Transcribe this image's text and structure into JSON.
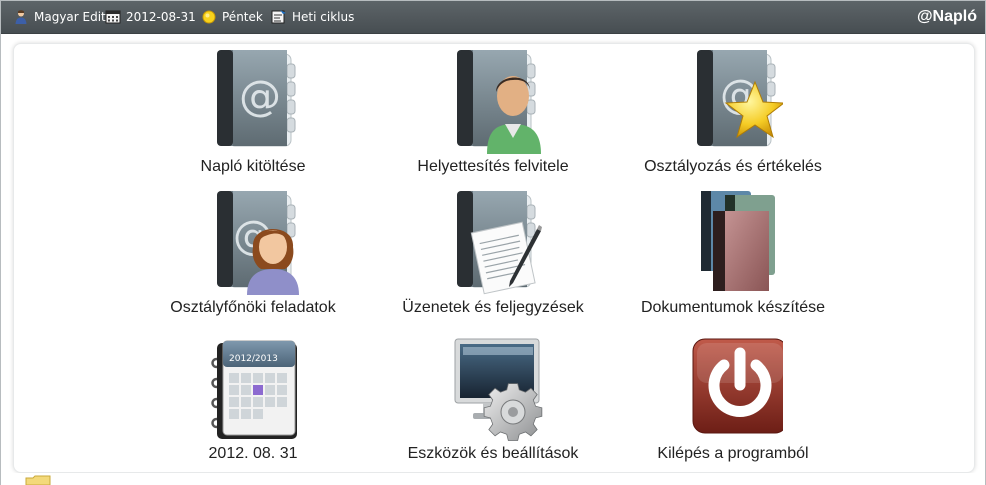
{
  "topbar": {
    "user": "Magyar Edit",
    "date": "2012-08-31",
    "weekday": "Péntek",
    "cycle": "Heti ciklus",
    "brand": "@Napló",
    "icons": {
      "user": "user-icon",
      "date": "calendar-icon",
      "weekday": "sun-icon",
      "cycle": "cycle-icon"
    }
  },
  "tiles": [
    {
      "label": "Napló kitöltése",
      "icon": "address-book-at-icon"
    },
    {
      "label": "Helyettesítés felvitele",
      "icon": "address-book-person-icon"
    },
    {
      "label": "Osztályozás és értékelés",
      "icon": "address-book-star-icon"
    },
    {
      "label": "Osztályfőnöki feladatok",
      "icon": "address-book-woman-icon"
    },
    {
      "label": "Üzenetek és feljegyzések",
      "icon": "address-book-letter-pen-icon"
    },
    {
      "label": "Dokumentumok készítése",
      "icon": "books-stack-icon"
    },
    {
      "label": "2012. 08. 31",
      "icon": "desk-calendar-icon"
    },
    {
      "label": "Eszközök és beállítások",
      "icon": "monitor-gear-icon"
    },
    {
      "label": "Kilépés a programból",
      "icon": "power-icon"
    }
  ],
  "colors": {
    "topbar": "#4f565a",
    "book_cover": "#6c7a82",
    "book_spine": "#2b2f32",
    "star": "#f3c324",
    "power": "#8e2f25"
  }
}
